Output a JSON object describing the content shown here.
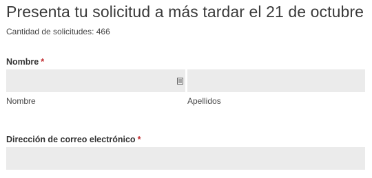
{
  "form": {
    "title": "Presenta tu solicitud a más tardar el 21 de octubre",
    "submission_count": "Cantidad de solicitudes: 466",
    "name_field": {
      "label": "Nombre",
      "required_mark": "*",
      "first": {
        "value": "",
        "sublabel": "Nombre"
      },
      "last": {
        "value": "",
        "sublabel": "Apellidos"
      },
      "autofill_icon": "contact-card-icon"
    },
    "email_field": {
      "label": "Dirección de correo electrónico",
      "required_mark": "*",
      "value": ""
    }
  }
}
